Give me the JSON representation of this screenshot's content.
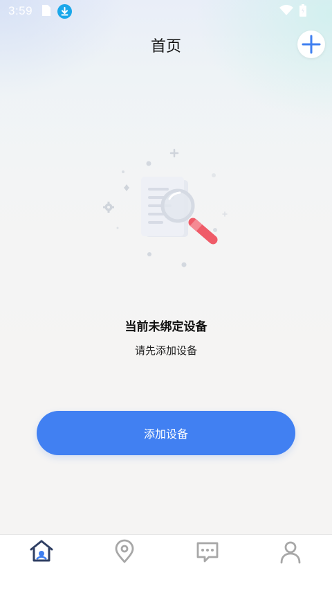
{
  "status_bar": {
    "time": "3:59",
    "icons": [
      "sim-card-icon",
      "download-icon",
      "wifi-icon",
      "battery-icon"
    ]
  },
  "header": {
    "title": "首页",
    "add_icon": "plus-icon"
  },
  "empty_state": {
    "illustration": "document-magnifier-illustration",
    "title": "当前未绑定设备",
    "subtitle": "请先添加设备"
  },
  "actions": {
    "add_device_label": "添加设备"
  },
  "bottom_nav": {
    "items": [
      {
        "icon": "home-icon",
        "active": true
      },
      {
        "icon": "location-pin-icon",
        "active": false
      },
      {
        "icon": "message-icon",
        "active": false
      },
      {
        "icon": "profile-icon",
        "active": false
      }
    ]
  },
  "colors": {
    "accent": "#4180f2",
    "nav_active": "#2f3f63",
    "nav_inactive": "#a7a7a7",
    "illustration_red": "#ef5b68"
  }
}
